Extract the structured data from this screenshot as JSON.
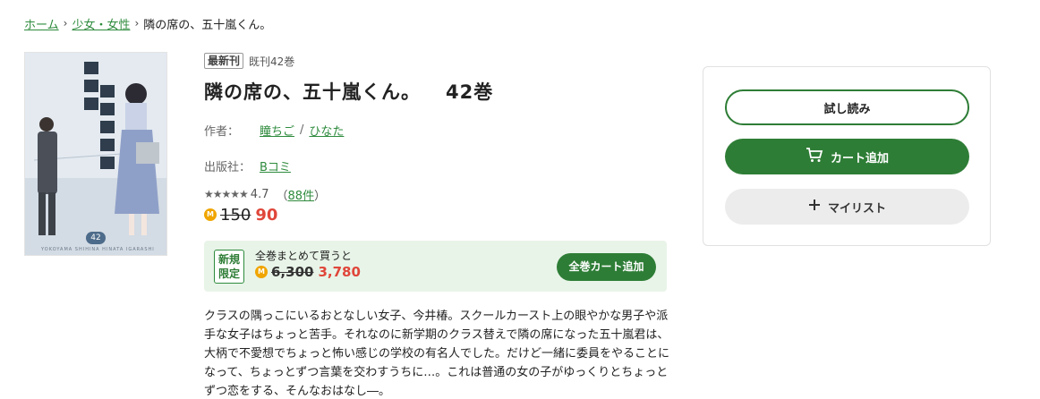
{
  "breadcrumb": {
    "home": "ホーム",
    "category": "少女・女性",
    "current": "隣の席の、五十嵐くん。"
  },
  "cover": {
    "volume_badge": "42",
    "bottom_text": "YOKOYAMA SHIHINA HINATA IGARASHI"
  },
  "product": {
    "tag_new": "最新刊",
    "tag_count": "既刊42巻",
    "title": "隣の席の、五十嵐くん。",
    "volume": "42巻",
    "author_label": "作者：",
    "author1": "瞳ちご",
    "author_sep": "/",
    "author2": "ひなた",
    "publisher_label": "出版社：",
    "publisher": "Bコミ",
    "stars": "★★★★★",
    "rating": "4.7",
    "review_open": "（",
    "review_count": "88件",
    "review_close": "）",
    "coin_icon": "M",
    "price_old": "150",
    "price_new": "90"
  },
  "bundle": {
    "limited_line1": "新規",
    "limited_line2": "限定",
    "label": "全巻まとめて買うと",
    "coin_icon": "M",
    "price_old": "6,300",
    "price_new": "3,780",
    "button": "全巻カート追加"
  },
  "description": "クラスの隅っこにいるおとなしい女子、今井椿。スクールカースト上の眼やかな男子や派手な女子はちょっと苦手。それなのに新学期のクラス替えで隣の席になった五十嵐君は、大柄で不愛想でちょっと怖い感じの学校の有名人でした。だけど一緒に委員をやることになって、ちょっとずつ言葉を交わすうちに…。これは普通の女の子がゆっくりとちょっとずつ恋をする、そんなおはなし―。",
  "actions": {
    "try_read": "試し読み",
    "add_cart": "カート追加",
    "cart_icon": "cart-icon",
    "my_list": "マイリスト",
    "plus_icon": "plus-icon"
  },
  "colors": {
    "accent": "#2e7d36",
    "link": "#2e8b3d",
    "price": "#e0463a",
    "coin": "#f0a500",
    "bundle_bg": "#e8f4e8"
  }
}
